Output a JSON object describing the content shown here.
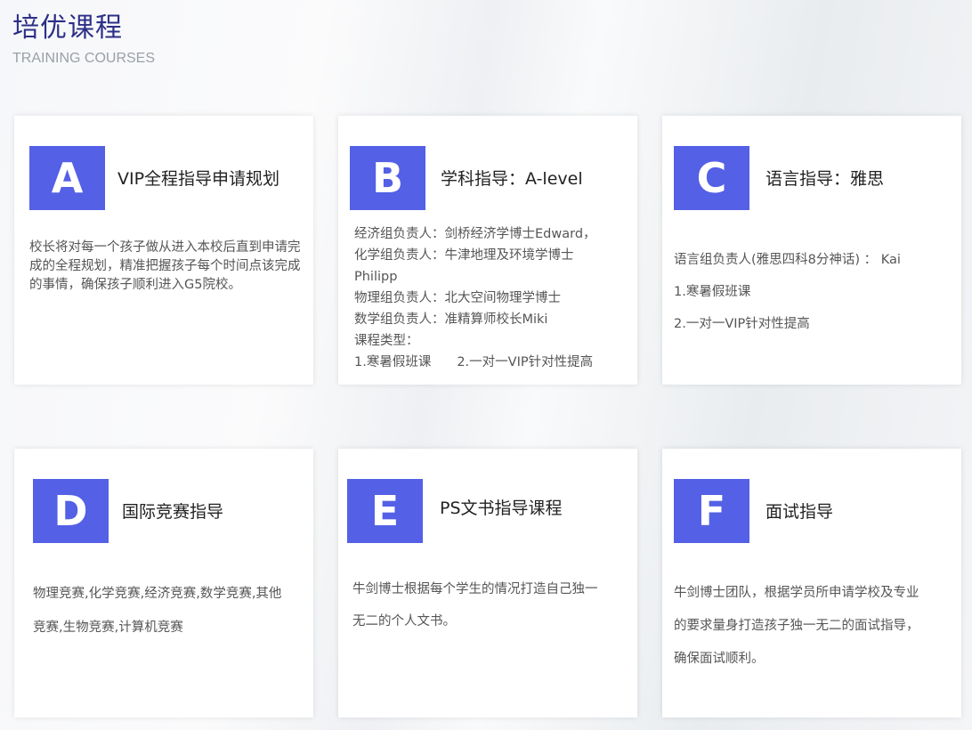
{
  "header": {
    "title": "培优课程",
    "subtitle": "TRAINING COURSES"
  },
  "colors": {
    "badge": "#5460e5",
    "title": "#2c2f86"
  },
  "cards": [
    {
      "letter": "A",
      "title": "VIP全程指导申请规划",
      "body": "校长将对每一个孩子做从进入本校后直到申请完成的全程规划，精准把握孩子每个时间点该完成的事情，确保孩子顺利进入G5院校。"
    },
    {
      "letter": "B",
      "title": "学科指导：A-level",
      "lines": [
        "经济组负责人：剑桥经济学博士Edward，",
        "化学组负责人：牛津地理及环境学博士",
        "Philipp",
        "物理组负责人：北大空间物理学博士",
        "数学组负责人：准精算师校长Miki",
        "课程类型：",
        "1.寒暑假班课　　2.一对一VIP针对性提高"
      ]
    },
    {
      "letter": "C",
      "title": "语言指导：雅思",
      "lines": [
        "语言组负责人(雅思四科8分神话) ： Kai",
        "1.寒暑假班课",
        "2.一对一VIP针对性提高"
      ]
    },
    {
      "letter": "D",
      "title": "国际竞赛指导",
      "lines": [
        "物理竞赛,化学竞赛,经济竞赛,数学竞赛,其他",
        "竞赛,生物竞赛,计算机竞赛"
      ]
    },
    {
      "letter": "E",
      "title": "PS文书指导课程",
      "lines": [
        "牛剑博士根据每个学生的情况打造自己独一",
        "无二的个人文书。"
      ]
    },
    {
      "letter": "F",
      "title": "面试指导",
      "lines": [
        "牛剑博士团队，根据学员所申请学校及专业",
        "的要求量身打造孩子独一无二的面试指导，",
        "确保面试顺利。"
      ]
    }
  ]
}
